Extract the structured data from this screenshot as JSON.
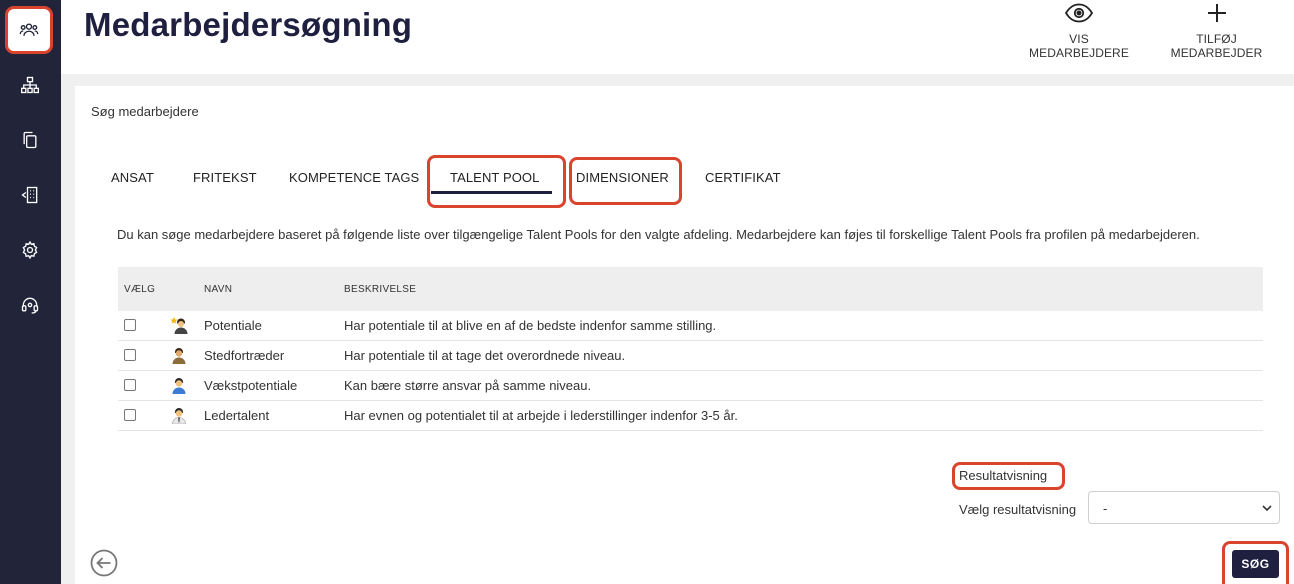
{
  "header": {
    "title": "Medarbejdersøgning",
    "actions": [
      {
        "label": "VIS MEDARBEJDERE",
        "icon": "eye-icon"
      },
      {
        "label": "TILFØJ MEDARBEJDER",
        "icon": "plus-icon"
      }
    ]
  },
  "sidebar": {
    "items": [
      {
        "icon": "users-icon",
        "active": true
      },
      {
        "icon": "org-chart-icon",
        "active": false
      },
      {
        "icon": "copy-icon",
        "active": false
      },
      {
        "icon": "building-icon",
        "active": false
      },
      {
        "icon": "gear-icon",
        "active": false
      },
      {
        "icon": "headset-icon",
        "active": false
      }
    ]
  },
  "search": {
    "label": "Søg medarbejdere",
    "tabs": [
      {
        "label": "ANSAT"
      },
      {
        "label": "FRITEKST"
      },
      {
        "label": "KOMPETENCE TAGS"
      },
      {
        "label": "TALENT POOL",
        "active": true
      },
      {
        "label": "DIMENSIONER"
      },
      {
        "label": "CERTIFIKAT"
      }
    ],
    "description": "Du kan søge medarbejdere baseret på følgende liste over tilgængelige Talent Pools for den valgte afdeling. Medarbejdere kan føjes til forskellige Talent Pools fra profilen på medarbejderen."
  },
  "table": {
    "columns": {
      "select": "VÆLG",
      "name": "NAVN",
      "description": "BESKRIVELSE"
    },
    "rows": [
      {
        "name": "Potentiale",
        "description": "Har potentiale til at blive en af de bedste indenfor samme stilling.",
        "checked": false,
        "icon": "star-person-icon"
      },
      {
        "name": "Stedfortræder",
        "description": "Har potentiale til at tage det overordnede niveau.",
        "checked": false,
        "icon": "person-icon"
      },
      {
        "name": "Vækstpotentiale",
        "description": "Kan bære større ansvar på samme niveau.",
        "checked": false,
        "icon": "person-blue-icon"
      },
      {
        "name": "Ledertalent",
        "description": "Har evnen og potentialet til at arbejde i lederstillinger indenfor 3-5 år.",
        "checked": false,
        "icon": "person-tie-icon"
      }
    ]
  },
  "result": {
    "heading": "Resultatvisning",
    "select_label": "Vælg resultatvisning",
    "select_value": "-"
  },
  "buttons": {
    "search": "SØG",
    "back_icon": "back-arrow-icon"
  },
  "colors": {
    "sidebar": "#22243a",
    "primary": "#1f2040",
    "highlight": "#d9442d",
    "table_header": "#eeeeee"
  }
}
